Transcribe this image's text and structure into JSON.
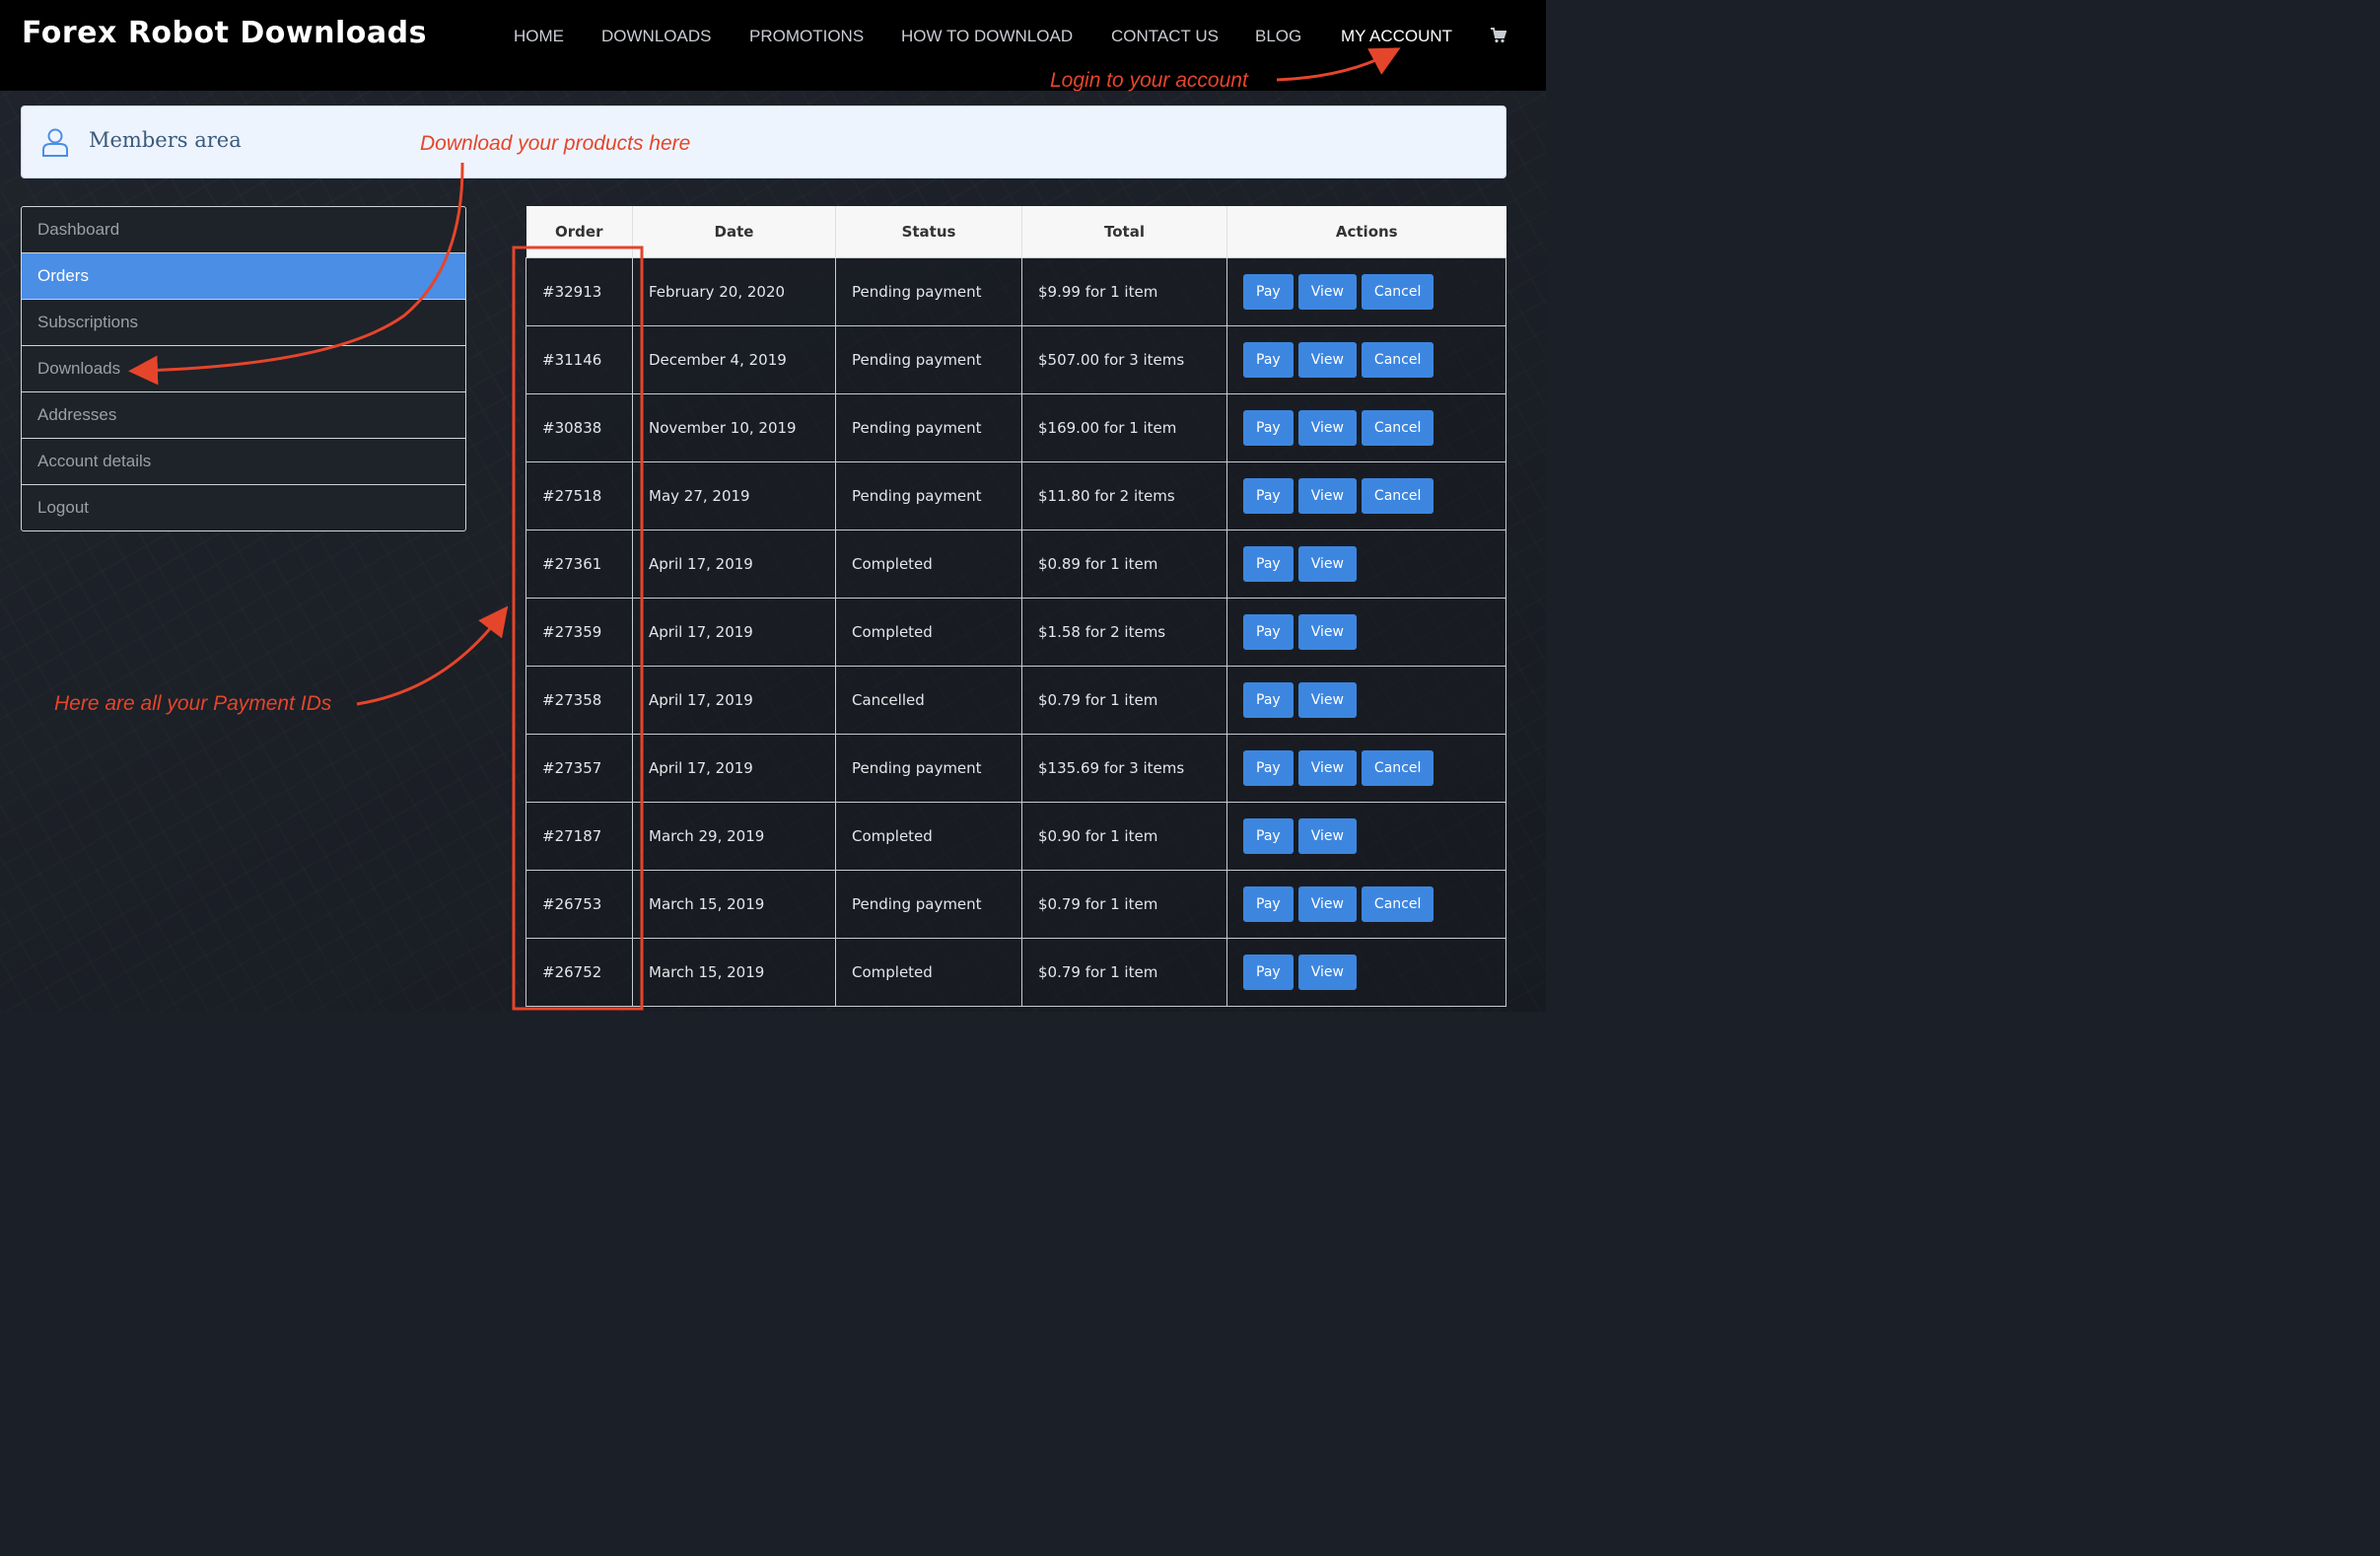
{
  "header": {
    "logo": "Forex Robot Downloads",
    "nav": [
      {
        "label": "HOME",
        "active": false
      },
      {
        "label": "DOWNLOADS",
        "active": false
      },
      {
        "label": "PROMOTIONS",
        "active": false
      },
      {
        "label": "HOW TO DOWNLOAD",
        "active": false
      },
      {
        "label": "CONTACT US",
        "active": false
      },
      {
        "label": "BLOG",
        "active": false
      },
      {
        "label": "MY ACCOUNT",
        "active": true
      }
    ],
    "cart_icon": "cart-icon"
  },
  "members": {
    "title": "Members area",
    "icon": "user-icon"
  },
  "sidebar": {
    "items": [
      {
        "label": "Dashboard",
        "active": false
      },
      {
        "label": "Orders",
        "active": true
      },
      {
        "label": "Subscriptions",
        "active": false
      },
      {
        "label": "Downloads",
        "active": false
      },
      {
        "label": "Addresses",
        "active": false
      },
      {
        "label": "Account details",
        "active": false
      },
      {
        "label": "Logout",
        "active": false
      }
    ]
  },
  "table": {
    "headers": [
      "Order",
      "Date",
      "Status",
      "Total",
      "Actions"
    ],
    "buttons": {
      "pay": "Pay",
      "view": "View",
      "cancel": "Cancel"
    },
    "rows": [
      {
        "order": "#32913",
        "date": "February 20, 2020",
        "status": "Pending payment",
        "total": "$9.99 for 1 item",
        "cancel": true
      },
      {
        "order": "#31146",
        "date": "December 4, 2019",
        "status": "Pending payment",
        "total": "$507.00 for 3 items",
        "cancel": true
      },
      {
        "order": "#30838",
        "date": "November 10, 2019",
        "status": "Pending payment",
        "total": "$169.00 for 1 item",
        "cancel": true
      },
      {
        "order": "#27518",
        "date": "May 27, 2019",
        "status": "Pending payment",
        "total": "$11.80 for 2 items",
        "cancel": true
      },
      {
        "order": "#27361",
        "date": "April 17, 2019",
        "status": "Completed",
        "total": "$0.89 for 1 item",
        "cancel": false
      },
      {
        "order": "#27359",
        "date": "April 17, 2019",
        "status": "Completed",
        "total": "$1.58 for 2 items",
        "cancel": false
      },
      {
        "order": "#27358",
        "date": "April 17, 2019",
        "status": "Cancelled",
        "total": "$0.79 for 1 item",
        "cancel": false
      },
      {
        "order": "#27357",
        "date": "April 17, 2019",
        "status": "Pending payment",
        "total": "$135.69 for 3 items",
        "cancel": true
      },
      {
        "order": "#27187",
        "date": "March 29, 2019",
        "status": "Completed",
        "total": "$0.90 for 1 item",
        "cancel": false
      },
      {
        "order": "#26753",
        "date": "March 15, 2019",
        "status": "Pending payment",
        "total": "$0.79 for 1 item",
        "cancel": true
      },
      {
        "order": "#26752",
        "date": "March 15, 2019",
        "status": "Completed",
        "total": "$0.79 for 1 item",
        "cancel": false
      }
    ]
  },
  "annotations": {
    "login": "Login to your account",
    "download": "Download your products here",
    "payment_ids": "Here are all your Payment IDs"
  },
  "colors": {
    "accent": "#4a8ee6",
    "button": "#3d86e0",
    "annotation": "#e5452b"
  }
}
